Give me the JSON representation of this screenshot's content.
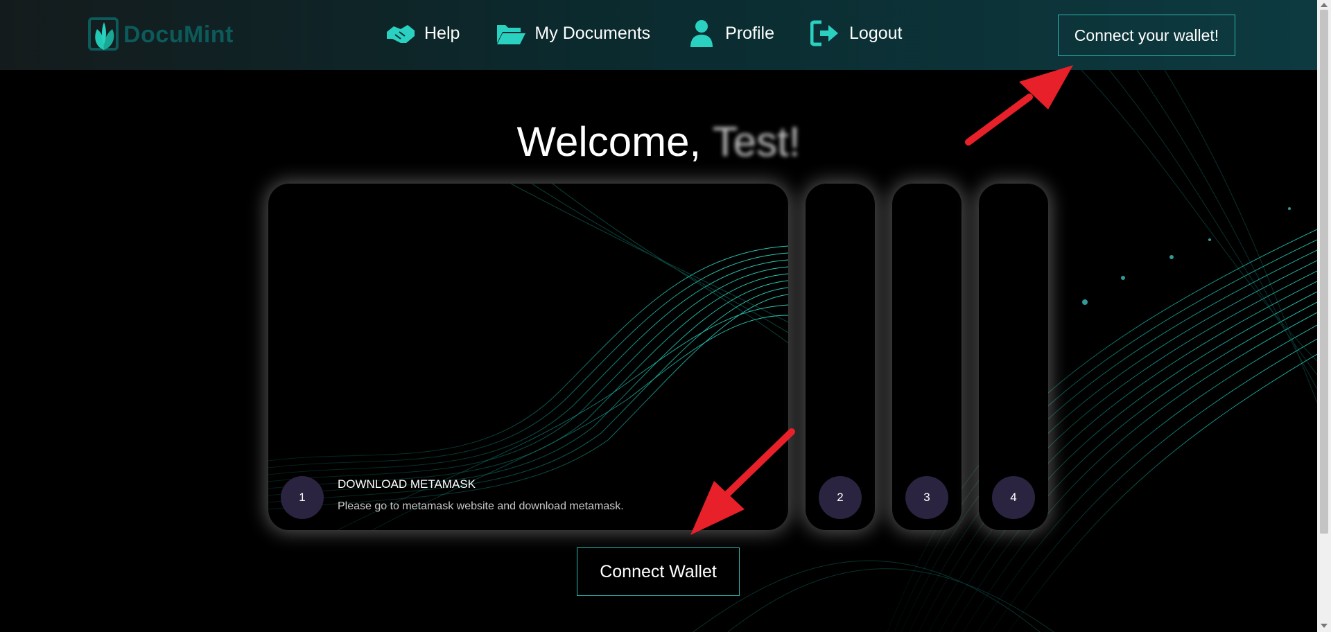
{
  "brand": {
    "name": "DocuMint",
    "logo_color": "#0d5a5a",
    "accent": "#2ad1c0"
  },
  "nav": {
    "items": [
      {
        "label": "Help",
        "icon": "handshake-icon"
      },
      {
        "label": "My Documents",
        "icon": "folder-open-icon"
      },
      {
        "label": "Profile",
        "icon": "user-icon"
      },
      {
        "label": "Logout",
        "icon": "logout-icon"
      }
    ],
    "wallet_button": "Connect your wallet!"
  },
  "welcome": {
    "greeting": "Welcome,",
    "username": "Test!"
  },
  "steps": [
    {
      "number": "1",
      "title": "DOWNLOAD METAMASK",
      "description": "Please go to metamask website and download metamask."
    },
    {
      "number": "2"
    },
    {
      "number": "3"
    },
    {
      "number": "4"
    }
  ],
  "connect_button": "Connect Wallet",
  "annotation_color": "#e8202a"
}
